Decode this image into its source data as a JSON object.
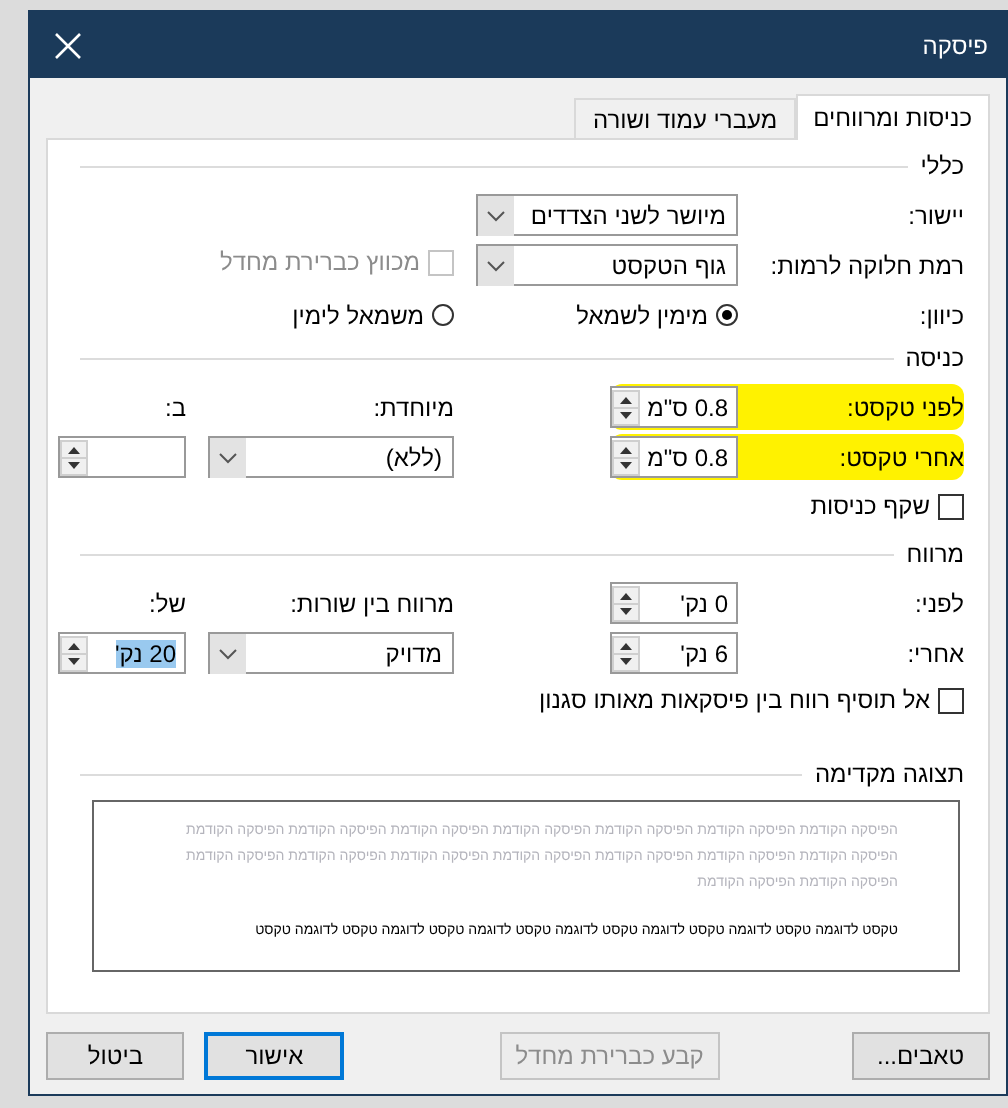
{
  "window": {
    "title": "פיסקה"
  },
  "tabs": [
    {
      "label": "כניסות ומרווחים",
      "selected": true
    },
    {
      "label": "מעברי עמוד ושורה",
      "selected": false
    }
  ],
  "general": {
    "title": "כללי",
    "alignment": {
      "label": "יישור:",
      "value": "מיושר לשני הצדדים"
    },
    "outline_level": {
      "label": "רמת חלוקה לרמות:",
      "value": "גוף הטקסט"
    },
    "collapsed": {
      "label": "מכווץ כברירת מחדל",
      "checked": false,
      "disabled": true
    },
    "direction": {
      "label": "כיוון:",
      "options": [
        {
          "label": "מימין לשמאל",
          "selected": true
        },
        {
          "label": "משמאל לימין",
          "selected": false
        }
      ]
    }
  },
  "indentation": {
    "title": "כניסה",
    "before": {
      "label": "לפני טקסט:",
      "value": "0.8 ס\"מ",
      "highlighted": true
    },
    "after": {
      "label": "אחרי טקסט:",
      "value": "0.8 ס\"מ",
      "highlighted": true
    },
    "special": {
      "label": "מיוחדת:",
      "value": "(ללא)"
    },
    "by": {
      "label": "ב:"
    },
    "mirror": {
      "label": "שקף כניסות",
      "checked": false
    }
  },
  "spacing": {
    "title": "מרווח",
    "before": {
      "label": "לפני:",
      "value": "0 נק'"
    },
    "after": {
      "label": "אחרי:",
      "value": "6 נק'"
    },
    "line_spacing": {
      "label": "מרווח בין שורות:",
      "value": "מדויק"
    },
    "at": {
      "label": "של:",
      "value": "20 נק'",
      "value_selected": true
    },
    "dont_add": {
      "label": "אל תוסיף רווח בין פיסקאות מאותו סגנון",
      "checked": false
    }
  },
  "preview": {
    "title": "תצוגה מקדימה",
    "previous_lines": [
      "הפיסקה הקודמת הפיסקה הקודמת הפיסקה הקודמת הפיסקה הקודמת הפיסקה הקודמת הפיסקה הקודמת הפיסקה הקודמת",
      "הפיסקה הקודמת הפיסקה הקודמת הפיסקה הקודמת הפיסקה הקודמת הפיסקה הקודמת הפיסקה הקודמת הפיסקה הקודמת",
      "הפיסקה הקודמת הפיסקה הקודמת"
    ],
    "sample_text": "טקסט לדוגמה טקסט לדוגמה טקסט לדוגמה טקסט לדוגמה טקסט לדוגמה טקסט לדוגמה טקסט לדוגמה טקסט"
  },
  "buttons": [
    {
      "label": "טאבים...",
      "kind": "normal",
      "disabled": false
    },
    {
      "label": "קבע כברירת מחדל",
      "kind": "normal",
      "disabled": true
    },
    {
      "label": "אישור",
      "kind": "default",
      "disabled": false
    },
    {
      "label": "ביטול",
      "kind": "normal",
      "disabled": false
    }
  ]
}
